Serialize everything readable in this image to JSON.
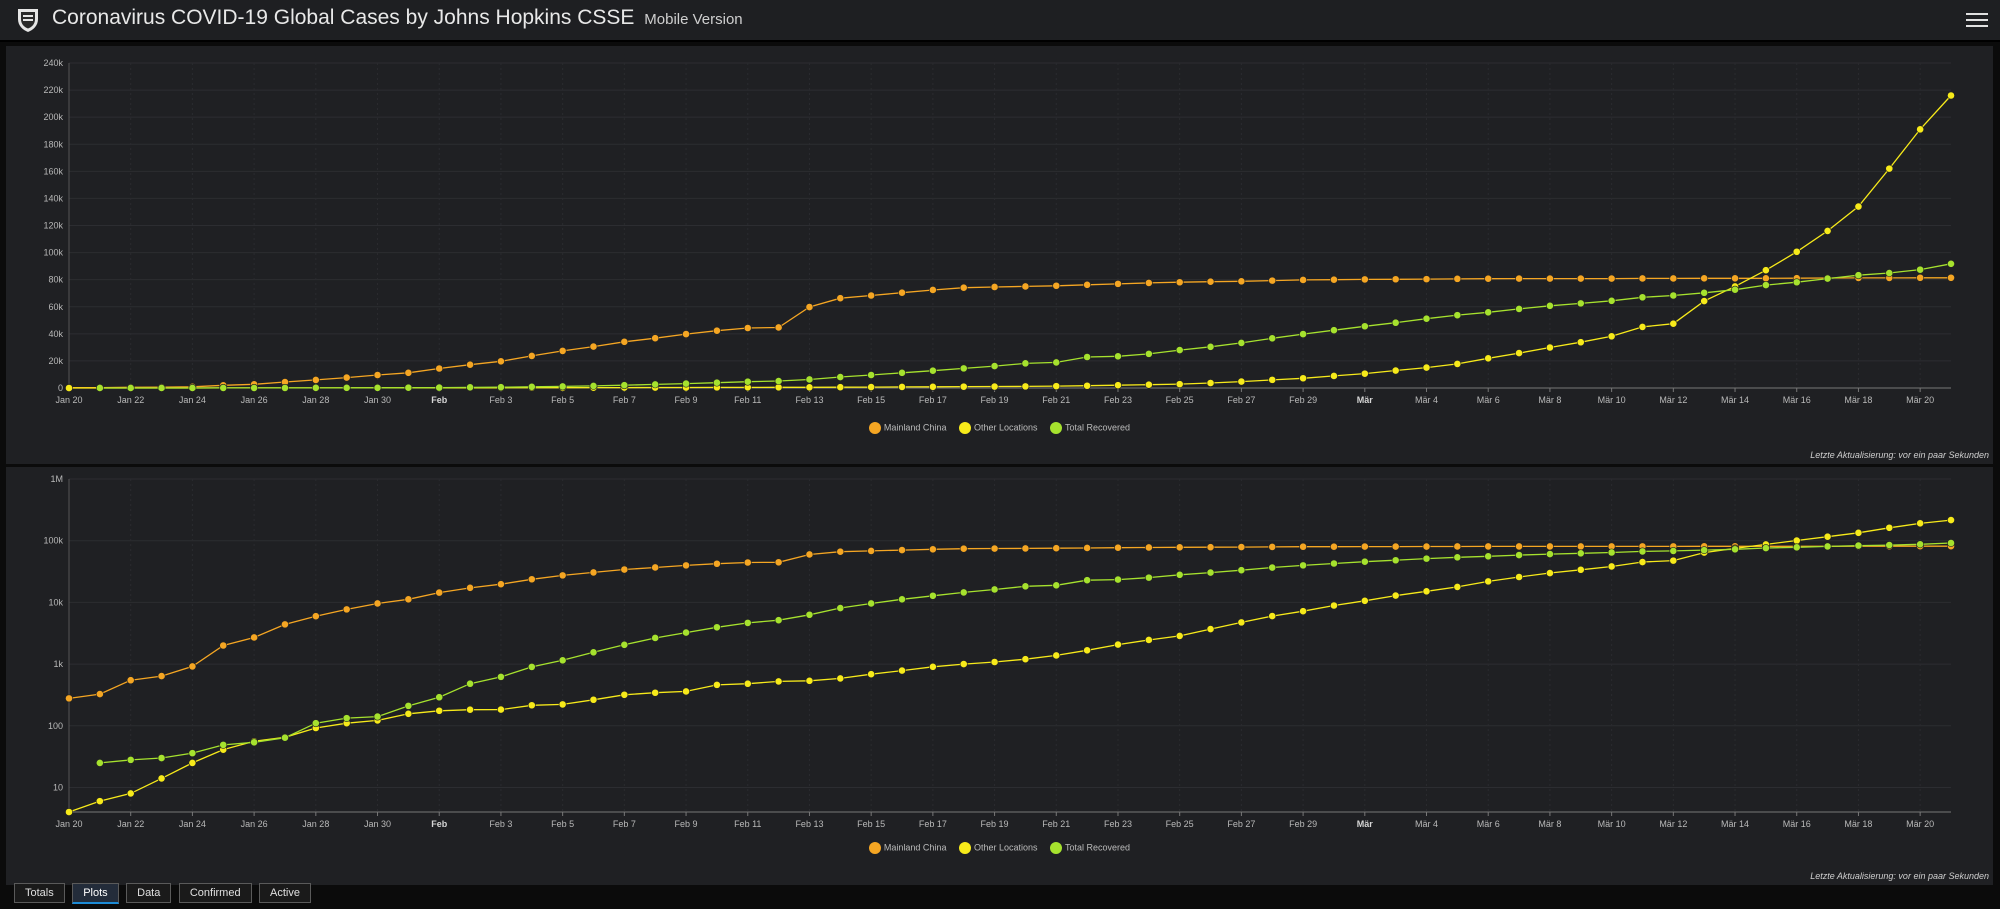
{
  "header": {
    "title": "Coronavirus COVID-19 Global Cases by Johns Hopkins CSSE",
    "subtitle": "Mobile Version"
  },
  "colors": {
    "mainland": "#f5a623",
    "other": "#f7ea1a",
    "recovered": "#a6e22e",
    "accent": "#1c8bd6"
  },
  "tabs": [
    {
      "label": "Totals",
      "active": false
    },
    {
      "label": "Plots",
      "active": true
    },
    {
      "label": "Data",
      "active": false
    },
    {
      "label": "Confirmed",
      "active": false
    },
    {
      "label": "Active",
      "active": false
    }
  ],
  "updated_text": "Letzte Aktualisierung: vor ein paar Sekunden",
  "chart_data": [
    {
      "type": "line",
      "scale": "linear",
      "ylim": [
        0,
        240000
      ],
      "yticks": [
        0,
        20000,
        40000,
        60000,
        80000,
        100000,
        120000,
        140000,
        160000,
        180000,
        200000,
        220000,
        240000
      ],
      "yticklabels": [
        "0",
        "20k",
        "40k",
        "60k",
        "80k",
        "100k",
        "120k",
        "140k",
        "160k",
        "180k",
        "200k",
        "220k",
        "240k"
      ],
      "xticklabels": [
        "Jan 20",
        "Jan 22",
        "Jan 24",
        "Jan 26",
        "Jan 28",
        "Jan 30",
        "Feb",
        "Feb 3",
        "Feb 5",
        "Feb 7",
        "Feb 9",
        "Feb 11",
        "Feb 13",
        "Feb 15",
        "Feb 17",
        "Feb 19",
        "Feb 21",
        "Feb 23",
        "Feb 25",
        "Feb 27",
        "Feb 29",
        "Mär",
        "Mär 4",
        "Mär 6",
        "Mär 8",
        "Mär 10",
        "Mär 12",
        "Mär 14",
        "Mär 16",
        "Mär 18",
        "Mär 20"
      ],
      "xticks_bold": [
        "Feb",
        "Mär"
      ],
      "x_start": "2020-01-20",
      "legend": [
        "Mainland China",
        "Other Locations",
        "Total Recovered"
      ],
      "grid": true,
      "series": [
        {
          "name": "Mainland China",
          "color": "#f5a623",
          "values": [
            278,
            326,
            547,
            639,
            916,
            2000,
            2700,
            4400,
            5970,
            7700,
            9600,
            11200,
            14400,
            17200,
            19700,
            23700,
            27400,
            30600,
            34100,
            36800,
            39800,
            42300,
            44300,
            44700,
            59800,
            66300,
            68300,
            70400,
            72400,
            74100,
            74600,
            75000,
            75500,
            76200,
            76900,
            77600,
            78100,
            78500,
            78800,
            79300,
            79800,
            80000,
            80200,
            80300,
            80400,
            80600,
            80700,
            80800,
            80800,
            80800,
            80800,
            80900,
            80900,
            81000,
            81000,
            81000,
            81100,
            81200,
            81300,
            81300,
            81400,
            81400
          ]
        },
        {
          "name": "Other Locations",
          "color": "#f7ea1a",
          "values": [
            4,
            6,
            8,
            14,
            25,
            41,
            56,
            65,
            92,
            110,
            122,
            156,
            175,
            182,
            183,
            215,
            222,
            264,
            318,
            343,
            360,
            460,
            480,
            523,
            535,
            585,
            685,
            785,
            903,
            1000,
            1080,
            1200,
            1380,
            1670,
            2070,
            2460,
            2860,
            3690,
            4740,
            6000,
            7200,
            8900,
            10600,
            12900,
            15100,
            17800,
            21900,
            25800,
            29900,
            33800,
            38200,
            45100,
            47500,
            64200,
            75000,
            87000,
            100600,
            116000,
            134000,
            162000,
            191000,
            216000
          ]
        },
        {
          "name": "Total Recovered",
          "color": "#a6e22e",
          "values": [
            null,
            25,
            28,
            30,
            36,
            49,
            54,
            64,
            110,
            133,
            141,
            210,
            290,
            480,
            620,
            900,
            1150,
            1550,
            2050,
            2650,
            3240,
            3950,
            4650,
            5150,
            6300,
            8100,
            9600,
            11200,
            12800,
            14500,
            16200,
            18200,
            18900,
            22900,
            23400,
            25200,
            28000,
            30400,
            33300,
            36700,
            39800,
            42700,
            45600,
            48200,
            51200,
            53800,
            55900,
            58400,
            60700,
            62500,
            64400,
            67000,
            68300,
            70300,
            72600,
            76000,
            78100,
            80800,
            83300,
            84900,
            87400,
            91700
          ]
        }
      ]
    },
    {
      "type": "line",
      "scale": "log",
      "ylim": [
        4,
        1000000
      ],
      "yticks": [
        10,
        100,
        1000,
        10000,
        100000,
        1000000
      ],
      "yticklabels": [
        "10",
        "100",
        "1k",
        "10k",
        "100k",
        "1M"
      ],
      "xticklabels": [
        "Jan 20",
        "Jan 22",
        "Jan 24",
        "Jan 26",
        "Jan 28",
        "Jan 30",
        "Feb",
        "Feb 3",
        "Feb 5",
        "Feb 7",
        "Feb 9",
        "Feb 11",
        "Feb 13",
        "Feb 15",
        "Feb 17",
        "Feb 19",
        "Feb 21",
        "Feb 23",
        "Feb 25",
        "Feb 27",
        "Feb 29",
        "Mär",
        "Mär 4",
        "Mär 6",
        "Mär 8",
        "Mär 10",
        "Mär 12",
        "Mär 14",
        "Mär 16",
        "Mär 18",
        "Mär 20"
      ],
      "xticks_bold": [
        "Feb",
        "Mär"
      ],
      "x_start": "2020-01-20",
      "legend": [
        "Mainland China",
        "Other Locations",
        "Total Recovered"
      ],
      "grid": true,
      "series": [
        {
          "name": "Mainland China",
          "color": "#f5a623",
          "values": [
            278,
            326,
            547,
            639,
            916,
            2000,
            2700,
            4400,
            5970,
            7700,
            9600,
            11200,
            14400,
            17200,
            19700,
            23700,
            27400,
            30600,
            34100,
            36800,
            39800,
            42300,
            44300,
            44700,
            59800,
            66300,
            68300,
            70400,
            72400,
            74100,
            74600,
            75000,
            75500,
            76200,
            76900,
            77600,
            78100,
            78500,
            78800,
            79300,
            79800,
            80000,
            80200,
            80300,
            80400,
            80600,
            80700,
            80800,
            80800,
            80800,
            80800,
            80900,
            80900,
            81000,
            81000,
            81000,
            81100,
            81200,
            81300,
            81300,
            81400,
            81400
          ]
        },
        {
          "name": "Other Locations",
          "color": "#f7ea1a",
          "values": [
            4,
            6,
            8,
            14,
            25,
            41,
            56,
            65,
            92,
            110,
            122,
            156,
            175,
            182,
            183,
            215,
            222,
            264,
            318,
            343,
            360,
            460,
            480,
            523,
            535,
            585,
            685,
            785,
            903,
            1000,
            1080,
            1200,
            1380,
            1670,
            2070,
            2460,
            2860,
            3690,
            4740,
            6000,
            7200,
            8900,
            10600,
            12900,
            15100,
            17800,
            21900,
            25800,
            29900,
            33800,
            38200,
            45100,
            47500,
            64200,
            75000,
            87000,
            100600,
            116000,
            134000,
            162000,
            191000,
            216000
          ]
        },
        {
          "name": "Total Recovered",
          "color": "#a6e22e",
          "values": [
            null,
            25,
            28,
            30,
            36,
            49,
            54,
            64,
            110,
            133,
            141,
            210,
            290,
            480,
            620,
            900,
            1150,
            1550,
            2050,
            2650,
            3240,
            3950,
            4650,
            5150,
            6300,
            8100,
            9600,
            11200,
            12800,
            14500,
            16200,
            18200,
            18900,
            22900,
            23400,
            25200,
            28000,
            30400,
            33300,
            36700,
            39800,
            42700,
            45600,
            48200,
            51200,
            53800,
            55900,
            58400,
            60700,
            62500,
            64400,
            67000,
            68300,
            70300,
            72600,
            76000,
            78100,
            80800,
            83300,
            84900,
            87400,
            91700
          ]
        }
      ]
    }
  ]
}
